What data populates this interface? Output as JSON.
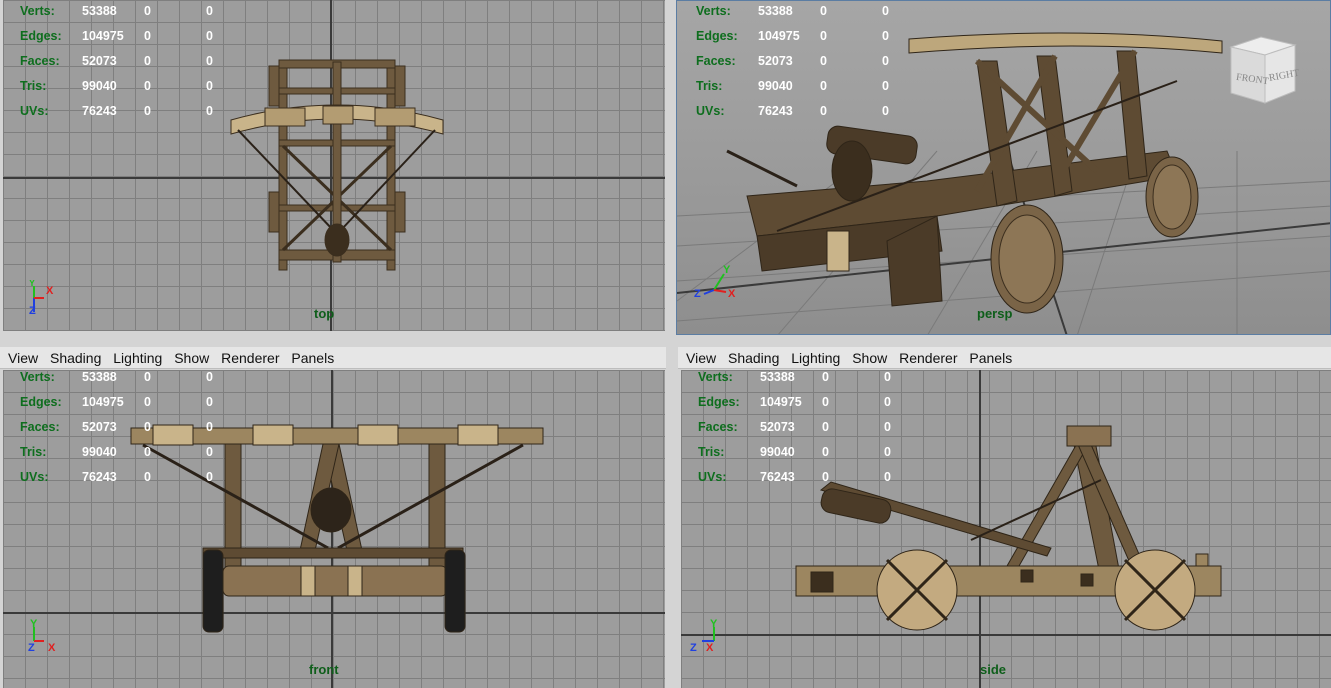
{
  "menu": [
    "View",
    "Shading",
    "Lighting",
    "Show",
    "Renderer",
    "Panels"
  ],
  "hud": [
    {
      "label": "Verts:",
      "value": "53388",
      "sel": "0",
      "comp": "0"
    },
    {
      "label": "Edges:",
      "value": "104975",
      "sel": "0",
      "comp": "0"
    },
    {
      "label": "Faces:",
      "value": "52073",
      "sel": "0",
      "comp": "0"
    },
    {
      "label": "Tris:",
      "value": "99040",
      "sel": "0",
      "comp": "0"
    },
    {
      "label": "UVs:",
      "value": "76243",
      "sel": "0",
      "comp": "0"
    }
  ],
  "viewports": {
    "top": {
      "name": "top"
    },
    "persp": {
      "name": "persp"
    },
    "front": {
      "name": "front"
    },
    "side": {
      "name": "side"
    }
  },
  "view_cube": {
    "front": "FRONT",
    "right": "RIGHT"
  },
  "axes": {
    "x": "X",
    "y": "Y",
    "z": "Z",
    "x_color": "#e02020",
    "y_color": "#20c020",
    "z_color": "#2040e0"
  },
  "colors": {
    "wood": "#6e5a3f",
    "rope": "#c9b48a",
    "grid": "#7f7f7f",
    "label": "#0e6e1e"
  }
}
